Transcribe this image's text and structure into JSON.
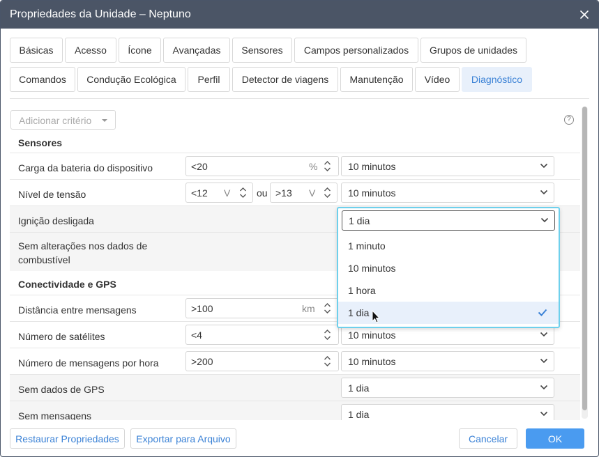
{
  "dialog": {
    "title": "Propriedades da Unidade – Neptuno"
  },
  "tabs": {
    "basicas": "Básicas",
    "acesso": "Acesso",
    "icone": "Ícone",
    "avancadas": "Avançadas",
    "sensores": "Sensores",
    "campos": "Campos personalizados",
    "grupos": "Grupos de unidades",
    "comandos": "Comandos",
    "conducao": "Condução Ecológica",
    "perfil": "Perfil",
    "detector": "Detector de viagens",
    "manutencao": "Manutenção",
    "video": "Vídeo",
    "diagnostico": "Diagnóstico"
  },
  "toolbar": {
    "add_criterion": "Adicionar critério",
    "help": "?"
  },
  "sections": {
    "sensores": "Sensores",
    "conectividade": "Conectividade e GPS"
  },
  "rows": {
    "bateria": {
      "label": "Carga da bateria do dispositivo",
      "value": "<20",
      "unit": "%",
      "period": "10 minutos"
    },
    "tensao": {
      "label": "Nível de tensão",
      "value1": "<12",
      "unit1": "V",
      "or": "ou",
      "value2": ">13",
      "unit2": "V",
      "period": "10 minutos"
    },
    "ignicao": {
      "label": "Ignição desligada",
      "period": "1 dia"
    },
    "combustivel": {
      "label_line1": "Sem alterações nos dados de",
      "label_line2": "combustível"
    },
    "distancia": {
      "label": "Distância entre mensagens",
      "value": ">100",
      "unit": "km"
    },
    "satelites": {
      "label": "Número de satélites",
      "value": "<4",
      "period": "10 minutos"
    },
    "mensagens_hora": {
      "label": "Número de mensagens por hora",
      "value": ">200",
      "period": "10 minutos"
    },
    "sem_gps": {
      "label": "Sem dados de GPS",
      "period": "1 dia"
    },
    "sem_mensagens": {
      "label": "Sem mensagens",
      "period": "1 dia"
    }
  },
  "dropdown": {
    "selected": "1 dia",
    "options": [
      "1 minuto",
      "10 minutos",
      "1 hora",
      "1 dia"
    ]
  },
  "footer": {
    "restore": "Restaurar Propriedades",
    "export": "Exportar para Arquivo",
    "cancel": "Cancelar",
    "ok": "OK"
  },
  "colors": {
    "titlebar": "#4b5566",
    "accent": "#3b82d6",
    "ok_button": "#4a9bf0",
    "active_tab_bg": "#e8f0fb",
    "dropdown_border": "#6ed0ec"
  }
}
